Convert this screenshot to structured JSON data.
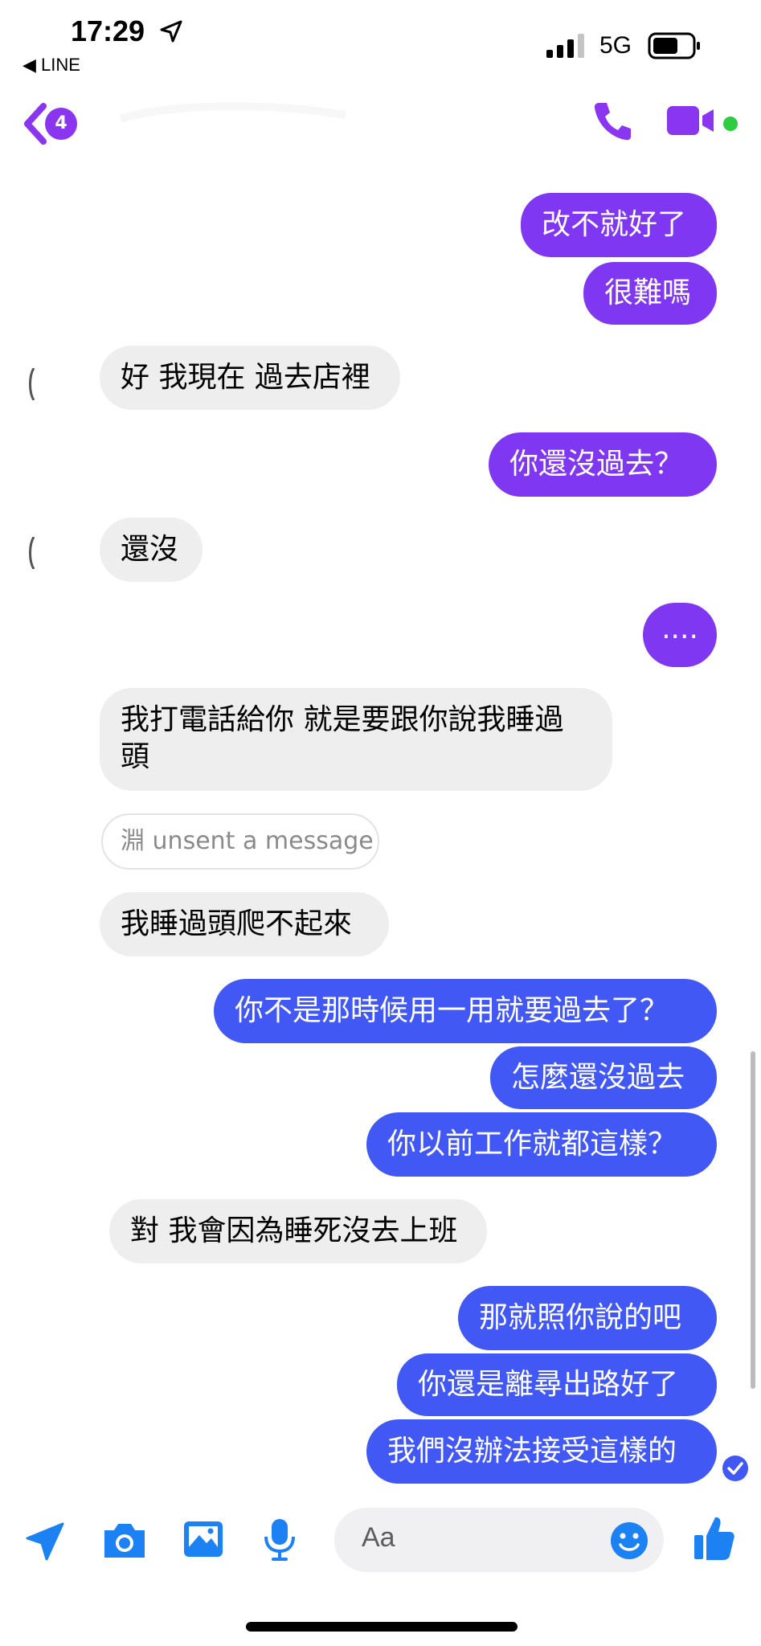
{
  "status_bar": {
    "time": "17:29",
    "back_app": "◀ LINE",
    "network": "5G"
  },
  "header": {
    "unread_count": "4",
    "accent_color": "#8a36f0",
    "icons": [
      "back-chevron-icon",
      "phone-icon",
      "video-camera-icon"
    ]
  },
  "messages": [
    {
      "side": "out",
      "text": "改不就好了"
    },
    {
      "side": "out",
      "text": "很難嗎"
    },
    {
      "side": "in",
      "text": "好 我現在 過去店裡"
    },
    {
      "side": "out",
      "text": "你還沒過去？"
    },
    {
      "side": "in",
      "text": "還沒"
    },
    {
      "side": "out",
      "text": "...."
    },
    {
      "side": "in",
      "line1": "我打電話給你 就是要跟你說我睡過",
      "line2": "頭"
    },
    {
      "side": "system",
      "text": "淵 unsent a message"
    },
    {
      "side": "in",
      "text": "我睡過頭爬不起來"
    },
    {
      "side": "out",
      "text": "你不是那時候用一用就要過去了？"
    },
    {
      "side": "out",
      "text": "怎麼還沒過去"
    },
    {
      "side": "out",
      "text": "你以前工作就都這樣？"
    },
    {
      "side": "in",
      "text": "對 我會因為睡死沒去上班"
    },
    {
      "side": "out",
      "text": "那就照你說的吧"
    },
    {
      "side": "out",
      "text": "你還是離尋出路好了"
    },
    {
      "side": "out",
      "text": "我們沒辦法接受這樣的"
    }
  ],
  "composer": {
    "placeholder": "Aa",
    "icons": [
      "send-location-icon",
      "camera-icon",
      "image-icon",
      "microphone-icon",
      "emoji-icon",
      "thumbs-up-icon"
    ]
  },
  "colors": {
    "outgoing_purple": "#7f37f2",
    "outgoing_blue": "#4158f5",
    "incoming_gray": "#eeeeef",
    "composer_icon_blue": "#1c82f3"
  }
}
